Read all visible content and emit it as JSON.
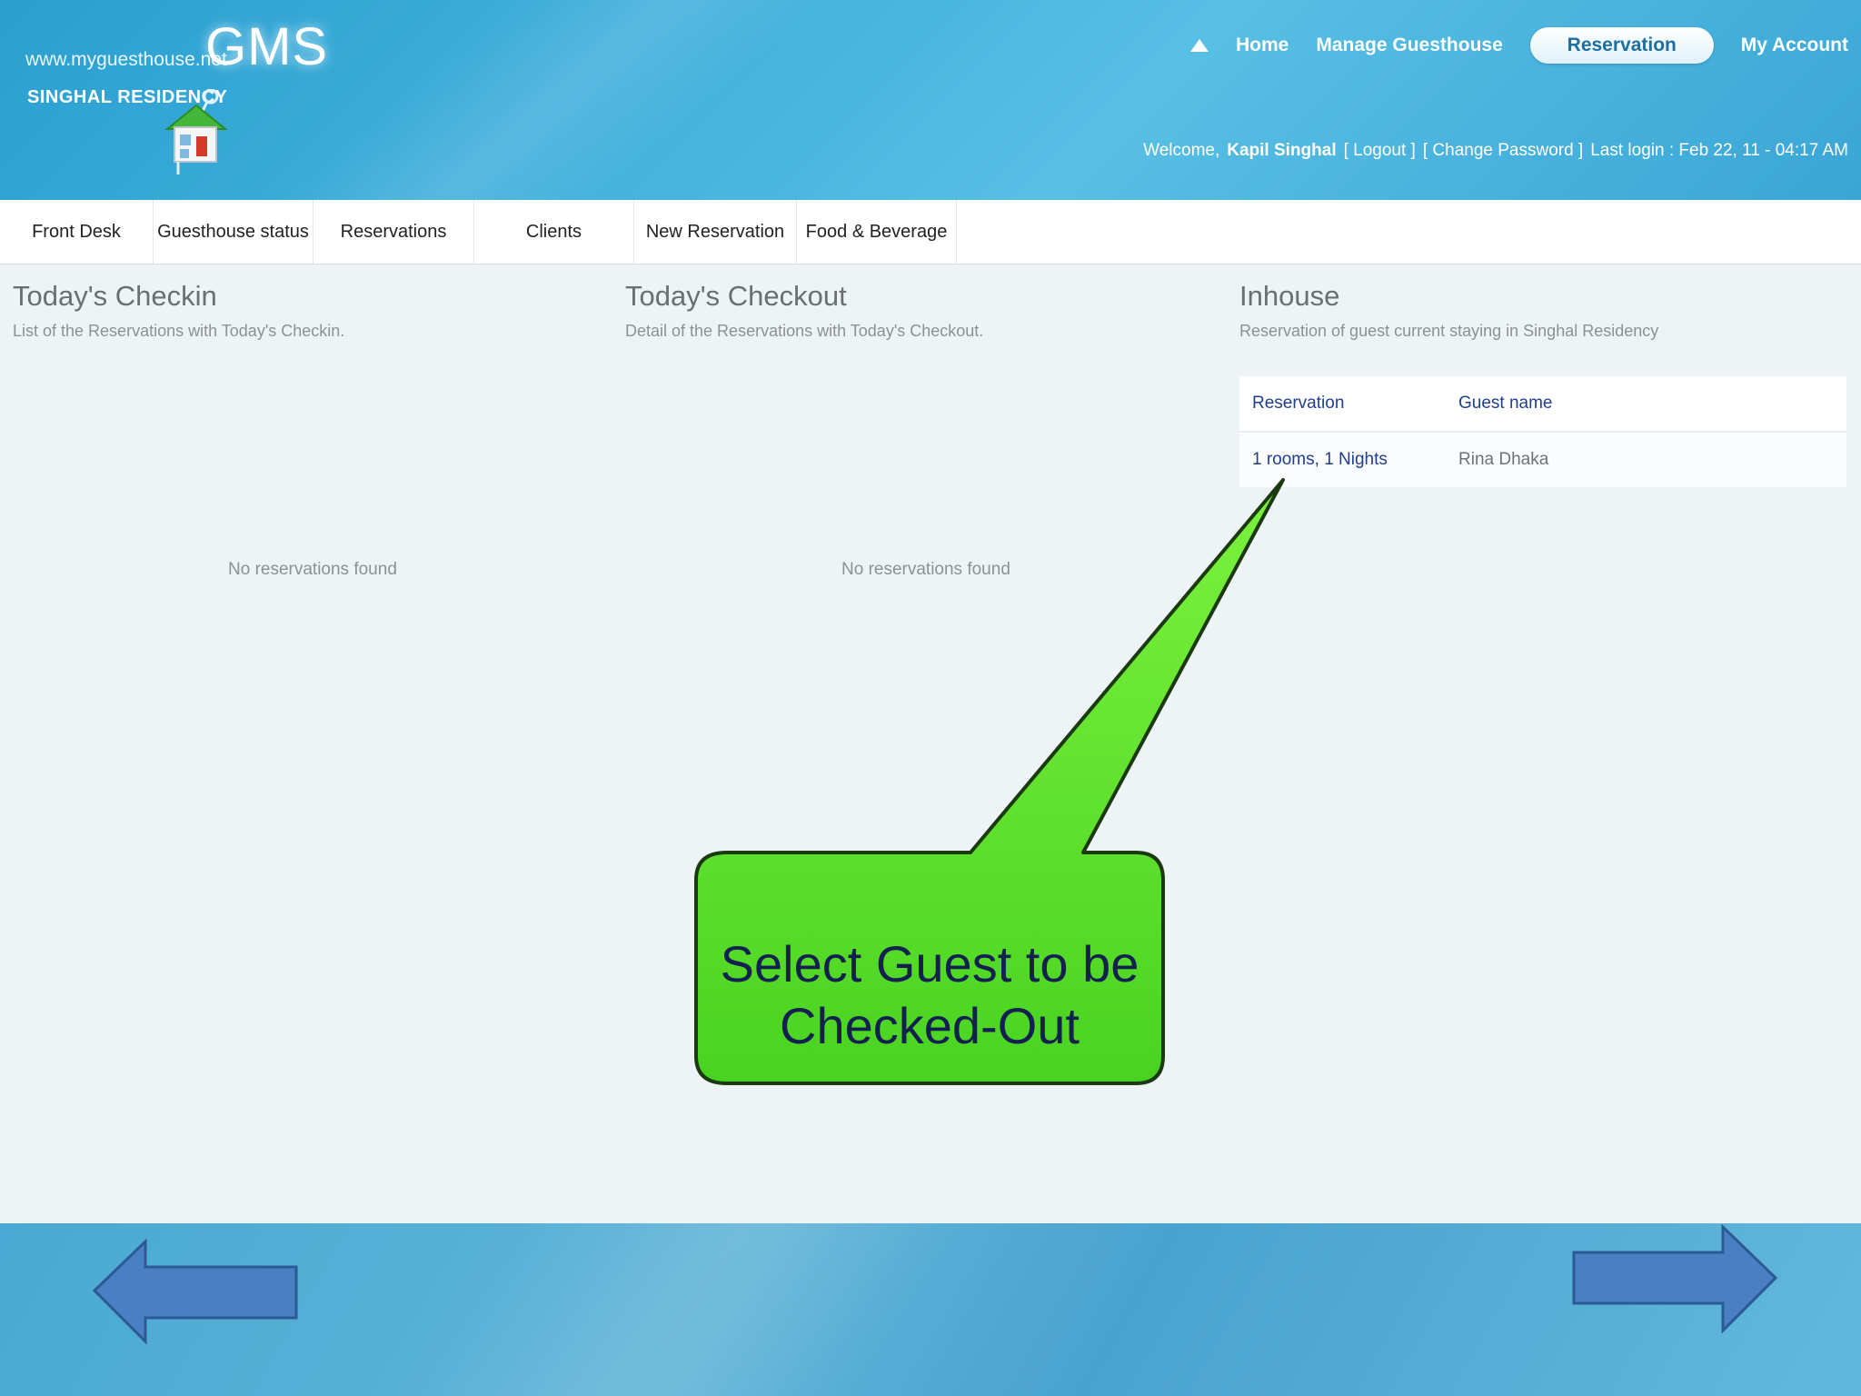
{
  "header": {
    "site_url": "www.myguesthouse.net",
    "logo": "GMS",
    "brand": "SINGHAL RESIDENCY"
  },
  "top_nav": {
    "home": "Home",
    "manage": "Manage Guesthouse",
    "reservation": "Reservation",
    "account": "My Account"
  },
  "welcome": {
    "prefix": "Welcome,",
    "user": "Kapil Singhal",
    "logout": "[ Logout ]",
    "change_password": "[ Change Password ]",
    "last_login": "Last login : Feb 22, 11 - 04:17 AM"
  },
  "menu": {
    "items": [
      "Front Desk",
      "Guesthouse status",
      "Reservations",
      "Clients",
      "New Reservation",
      "Food & Beverage"
    ]
  },
  "checkin": {
    "title": "Today's Checkin",
    "subtitle": "List of the Reservations with Today's Checkin.",
    "empty": "No reservations found"
  },
  "checkout": {
    "title": "Today's Checkout",
    "subtitle": "Detail of the Reservations with Today's Checkout.",
    "empty": "No reservations found"
  },
  "inhouse": {
    "title": "Inhouse",
    "subtitle": "Reservation of guest current staying in Singhal Residency",
    "columns": [
      "Reservation",
      "Guest name"
    ],
    "rows": [
      {
        "reservation": "1 rooms, 1 Nights",
        "guest": "Rina Dhaka"
      }
    ]
  },
  "callout": {
    "text": "Select Guest to be Checked-Out",
    "color": "#5fe62a"
  },
  "footer": {
    "prev_icon": "arrow-left-icon",
    "next_icon": "arrow-right-icon",
    "arrow_color": "#4a7fc4"
  }
}
